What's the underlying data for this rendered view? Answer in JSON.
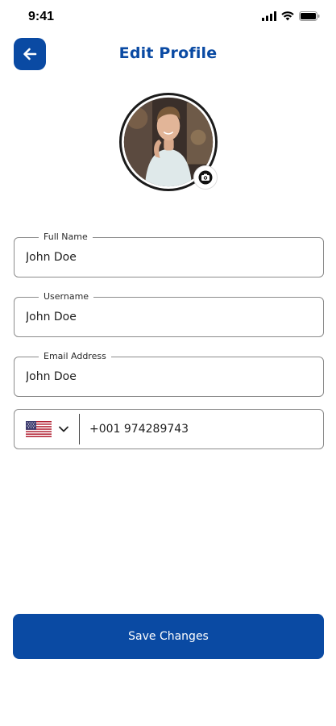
{
  "status_bar": {
    "time": "9:41",
    "icons": [
      "signal-icon",
      "wifi-icon",
      "battery-icon"
    ]
  },
  "header": {
    "title": "Edit Profile",
    "back_icon": "arrow-left-icon"
  },
  "avatar": {
    "camera_icon": "camera-icon"
  },
  "form": {
    "full_name": {
      "label": "Full Name",
      "value": "John Doe"
    },
    "username": {
      "label": "Username",
      "value": "John Doe"
    },
    "email": {
      "label": "Email Address",
      "value": "John Doe"
    },
    "phone": {
      "country_flag": "us-flag-icon",
      "value": "+001 974289743"
    }
  },
  "actions": {
    "save_label": "Save Changes"
  },
  "colors": {
    "primary": "#0a4aa3",
    "border": "#8c8c8c",
    "background": "#ffffff"
  }
}
